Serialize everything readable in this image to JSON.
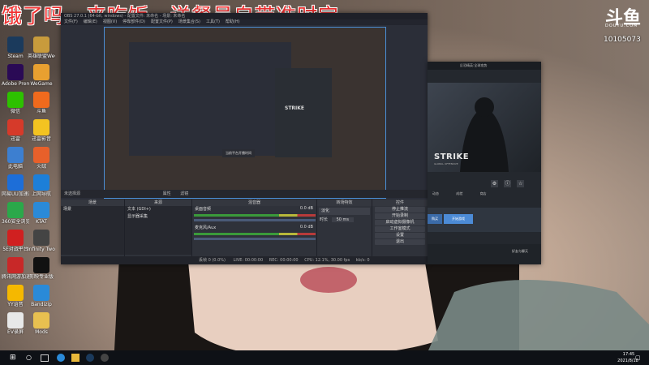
{
  "overlay": {
    "message": "饿了吗，来吃饭，送餐员自带准时宝"
  },
  "logo": {
    "mark": "斗鱼",
    "url": "DOUYU.COM",
    "room_id": "10105073"
  },
  "desktop_icons": [
    {
      "label": "Steam",
      "color": "#1b3a5c"
    },
    {
      "label": "英雄联盟WeGame",
      "color": "#c89b3c"
    },
    {
      "label": "Adobe Premiere",
      "color": "#2a0a55"
    },
    {
      "label": "WeGame",
      "color": "#e8a030"
    },
    {
      "label": "微信",
      "color": "#2dc100"
    },
    {
      "label": "斗鱼",
      "color": "#f06a1d"
    },
    {
      "label": "迅雷",
      "color": "#d63a2a"
    },
    {
      "label": "迅雷影音",
      "color": "#f3c321"
    },
    {
      "label": "此电脑",
      "color": "#3d7fd0"
    },
    {
      "label": "火绒",
      "color": "#e8602a"
    },
    {
      "label": "网易UU加速器",
      "color": "#1d6ed8"
    },
    {
      "label": "上网导航",
      "color": "#1d7fd8"
    },
    {
      "label": "360安全浏览器",
      "color": "#2ba84a"
    },
    {
      "label": "KTAT",
      "color": "#2b8ad8"
    },
    {
      "label": "5E对战平台",
      "color": "#d02020"
    },
    {
      "label": "Infinity Two Pro",
      "color": "#444444"
    },
    {
      "label": "腾讯网游加速",
      "color": "#c82828"
    },
    {
      "label": "剪映专业版",
      "color": "#111111"
    },
    {
      "label": "YY语音",
      "color": "#f5b800"
    },
    {
      "label": "Bandizip",
      "color": "#2a8ad8"
    },
    {
      "label": "EV录屏",
      "color": "#e8e8e8"
    },
    {
      "label": "Mods",
      "color": "#e8c050"
    }
  ],
  "obs": {
    "title": "OBS 27.0.1 (64-bit, windows) - 配置文件: 未命名 - 场景: 未命名",
    "menu": [
      "文件(F)",
      "编辑(E)",
      "视图(V)",
      "停靠部件(D)",
      "配置文件(P)",
      "场景集合(S)",
      "工具(T)",
      "帮助(H)"
    ],
    "preview_popup": "当前平台开播时间",
    "bar": {
      "no_source": "未选择源",
      "properties": "属性",
      "filters": "滤镜"
    },
    "docks": {
      "scenes": {
        "title": "场景",
        "items": [
          "场景"
        ]
      },
      "sources": {
        "title": "来源",
        "items": [
          "文本 (GDI+)",
          "显示器采集"
        ]
      },
      "mixer": {
        "title": "混音器",
        "channels": [
          {
            "name": "桌面音频",
            "level": "0.0 dB"
          },
          {
            "name": "麦克风/Aux",
            "level": "0.0 dB"
          }
        ]
      },
      "transitions": {
        "title": "转场特效",
        "type": "淡化",
        "duration_label": "时长",
        "duration": "50 ms"
      },
      "controls": {
        "title": "控件",
        "buttons": [
          "停止推流",
          "开始录制",
          "启动虚拟摄像机",
          "工作室模式",
          "设置",
          "退出"
        ]
      }
    },
    "status": {
      "dropped": "丢帧 0 (0.0%)",
      "live_label": "LIVE:",
      "live_time": "00:00:00",
      "rec_label": "REC:",
      "rec_time": "00:00:00",
      "cpu": "CPU: 12.1%,",
      "fps": "30.00 fps",
      "bitrate": "kb/s: 0"
    }
  },
  "game_window": {
    "title": "反恐精英:全球攻势",
    "game_name": "STRIKE",
    "game_sub": "GLOBAL OFFENSIVE",
    "tabs": [
      "动态",
      "成就",
      "商店"
    ],
    "play_button": "开始游戏",
    "store_button": "购买",
    "footer": "好友与聊天"
  },
  "taskbar": {
    "time": "17:45",
    "date": "2021/8/18"
  }
}
